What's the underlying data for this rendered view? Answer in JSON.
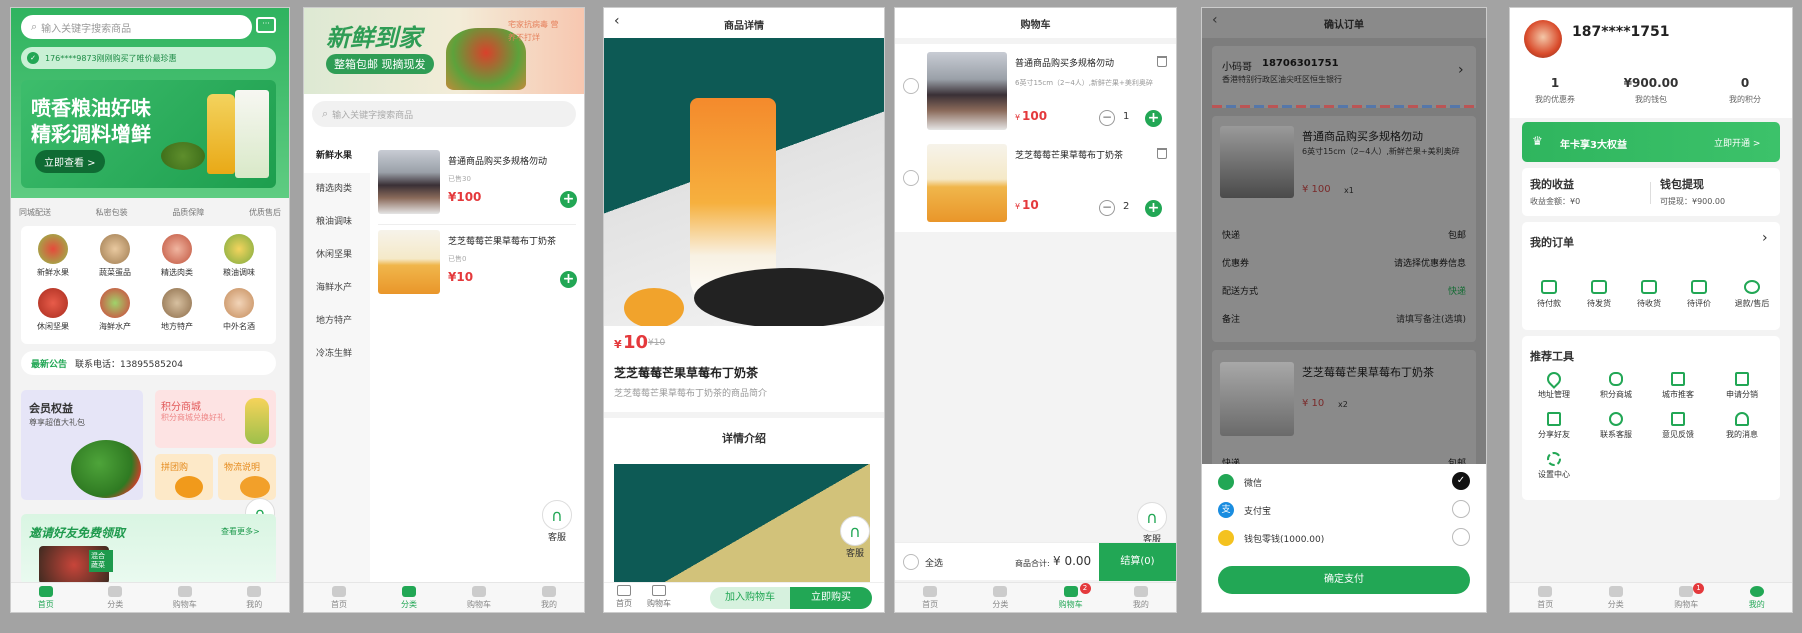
{
  "colors": {
    "accent": "#22a755",
    "price": "#e4393c"
  },
  "tabbar": {
    "home": "首页",
    "category": "分类",
    "cart": "购物车",
    "mine": "我的"
  },
  "cs_label": "客服",
  "s1": {
    "search_placeholder": "输入关键字搜索商品",
    "notice_ticker": "176****9873刚刚购买了唯价最珍惠",
    "banner_line1": "喷香粮油好味",
    "banner_line2": "精彩调料增鲜",
    "banner_button": "立即查看 >",
    "features": [
      "同城配送",
      "私密包装",
      "品质保障",
      "优质售后"
    ],
    "categories": [
      "新鲜水果",
      "蔬菜蛋品",
      "精选肉类",
      "粮油调味",
      "休闲坚果",
      "海鲜水产",
      "地方特产",
      "中外名酒"
    ],
    "announcement_label": "最新公告",
    "announcement_text": "联系电话：13895585204",
    "promo1_title": "会员权益",
    "promo1_sub": "尊享超值大礼包",
    "promo2_title": "积分商城",
    "promo2_sub": "积分商城兑换好礼",
    "promo3_title": "拼团购",
    "promo4_title": "物流说明",
    "invite_title": "邀请好友免费领取",
    "invite_more": "查看更多>",
    "invite_badge": "混合蔬菜"
  },
  "s2": {
    "banner_title": "新鲜到家",
    "banner_sub": "整箱包邮 现摘现发",
    "banner_side": "宅家抗病毒 营养不打烊",
    "search_placeholder": "输入关键字搜索商品",
    "sidebar": [
      "新鲜水果",
      "精选肉类",
      "粮油调味",
      "休闲坚果",
      "海鲜水产",
      "地方特产",
      "冷冻生鲜"
    ],
    "products": [
      {
        "name": "普通商品购买多规格勿动",
        "sold": "已售30",
        "price": "¥100"
      },
      {
        "name": "芝芝莓莓芒果草莓布丁奶茶",
        "sold": "已售0",
        "price": "¥10"
      }
    ]
  },
  "s3": {
    "title": "商品详情",
    "price": "10",
    "price_symbol": "¥",
    "orig_price": "¥10",
    "name": "芝芝莓莓芒果草莓布丁奶茶",
    "desc": "芝芝莓莓芒果草莓布丁奶茶的商品简介",
    "detail_title": "详情介绍",
    "home": "首页",
    "cart": "购物车",
    "add_cart": "加入购物车",
    "buy_now": "立即购买"
  },
  "s4": {
    "title": "购物车",
    "items": [
      {
        "name": "普通商品购买多规格勿动",
        "spec": "6英寸15cm（2~4人）,新鲜芒果+美利奥碎",
        "price": "100",
        "qty": "1"
      },
      {
        "name": "芝芝莓莓芒果草莓布丁奶茶",
        "spec": "",
        "price": "10",
        "qty": "2"
      }
    ],
    "select_all": "全选",
    "total_label": "商品合计:",
    "total_value": "¥ 0.00",
    "checkout": "结算(0)",
    "cart_badge": "2"
  },
  "s5": {
    "title": "确认订单",
    "addr_name": "小码哥",
    "addr_phone": "18706301751",
    "addr_detail": "香港特别行政区油尖旺区恒生银行",
    "items": [
      {
        "name": "普通商品购买多规格勿动",
        "spec": "6英寸15cm（2~4人）,新鲜芒果+美利奥碎",
        "price": "¥ 100",
        "qty": "x1"
      },
      {
        "name": "芝芝莓莓芒果草莓布丁奶茶",
        "spec": "",
        "price": "¥ 10",
        "qty": "x2"
      }
    ],
    "rows": [
      {
        "label": "快递",
        "value": "包邮"
      },
      {
        "label": "优惠券",
        "value": "请选择优惠券信息"
      },
      {
        "label": "配送方式",
        "value": "快递"
      },
      {
        "label": "备注",
        "value": "请填写备注(选填)"
      }
    ],
    "row_shipping2_label": "快递",
    "row_shipping2_value": "包邮",
    "pay": [
      "微信",
      "支付宝",
      "钱包零钱(1000.00)"
    ],
    "confirm": "确定支付"
  },
  "s6": {
    "phone": "187****1751",
    "stats": [
      {
        "value": "1",
        "label": "我的优惠券"
      },
      {
        "value": "¥900.00",
        "label": "我的钱包"
      },
      {
        "value": "0",
        "label": "我的积分"
      }
    ],
    "vip_text": "年卡享3大权益",
    "vip_btn": "立即开通 >",
    "earn_title": "我的收益",
    "earn_sub": "收益金额：¥0",
    "withdraw_title": "钱包提现",
    "withdraw_sub": "可提现：¥900.00",
    "orders_title": "我的订单",
    "orders": [
      "待付款",
      "待发货",
      "待收货",
      "待评价",
      "退款/售后"
    ],
    "tools_title": "推荐工具",
    "tools": [
      "地址管理",
      "积分商城",
      "城市推客",
      "申请分销",
      "分享好友",
      "联系客服",
      "意见反馈",
      "我的消息",
      "设置中心"
    ],
    "msg_badge": "1"
  }
}
